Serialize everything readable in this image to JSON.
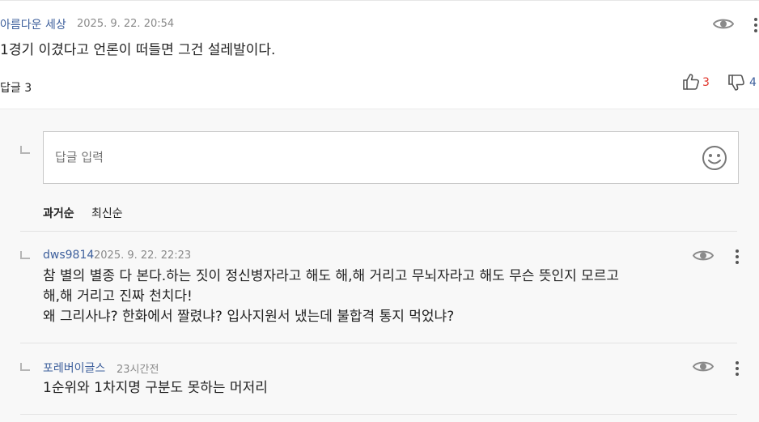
{
  "main_comment": {
    "author": "아름다운 세상",
    "date": "2025. 9. 22. 20:54",
    "text": "1경기 이겼다고 언론이 떠들면 그건 설레발이다.",
    "reply_label": "답글",
    "reply_count": "3",
    "likes": "3",
    "dislikes": "4"
  },
  "reply_input": {
    "placeholder": "답글 입력"
  },
  "sort": {
    "oldest": "과거순",
    "newest": "최신순"
  },
  "replies": [
    {
      "author": "dws9814",
      "date": "2025. 9. 22. 22:23",
      "lines": [
        "참 별의 별종 다 본다.하는 짓이 정신병자라고 해도 해,해 거리고 무뇌자라고 해도 무슨 뜻인지 모르고",
        "해,해 거리고 진짜 천치다!",
        "왜 그리사냐?  한화에서 짤렸냐? 입사지원서 냈는데 불합격 통지 먹었냐?"
      ]
    },
    {
      "author": "포레버이글스",
      "date": "23시간전",
      "lines": [
        "1순위와 1차지명 구분도 못하는 머저리"
      ]
    }
  ],
  "icons": {
    "view": "eye-icon",
    "more": "more-vertical-icon",
    "like": "thumbs-up-icon",
    "dislike": "thumbs-down-icon",
    "emoji": "smiley-icon",
    "reply_arrow": "reply-arrow-icon"
  },
  "colors": {
    "author": "#3d5f9c",
    "like_count": "#e0352b",
    "dislike_count": "#3d5f9c",
    "reply_background": "#f8f8f8"
  }
}
